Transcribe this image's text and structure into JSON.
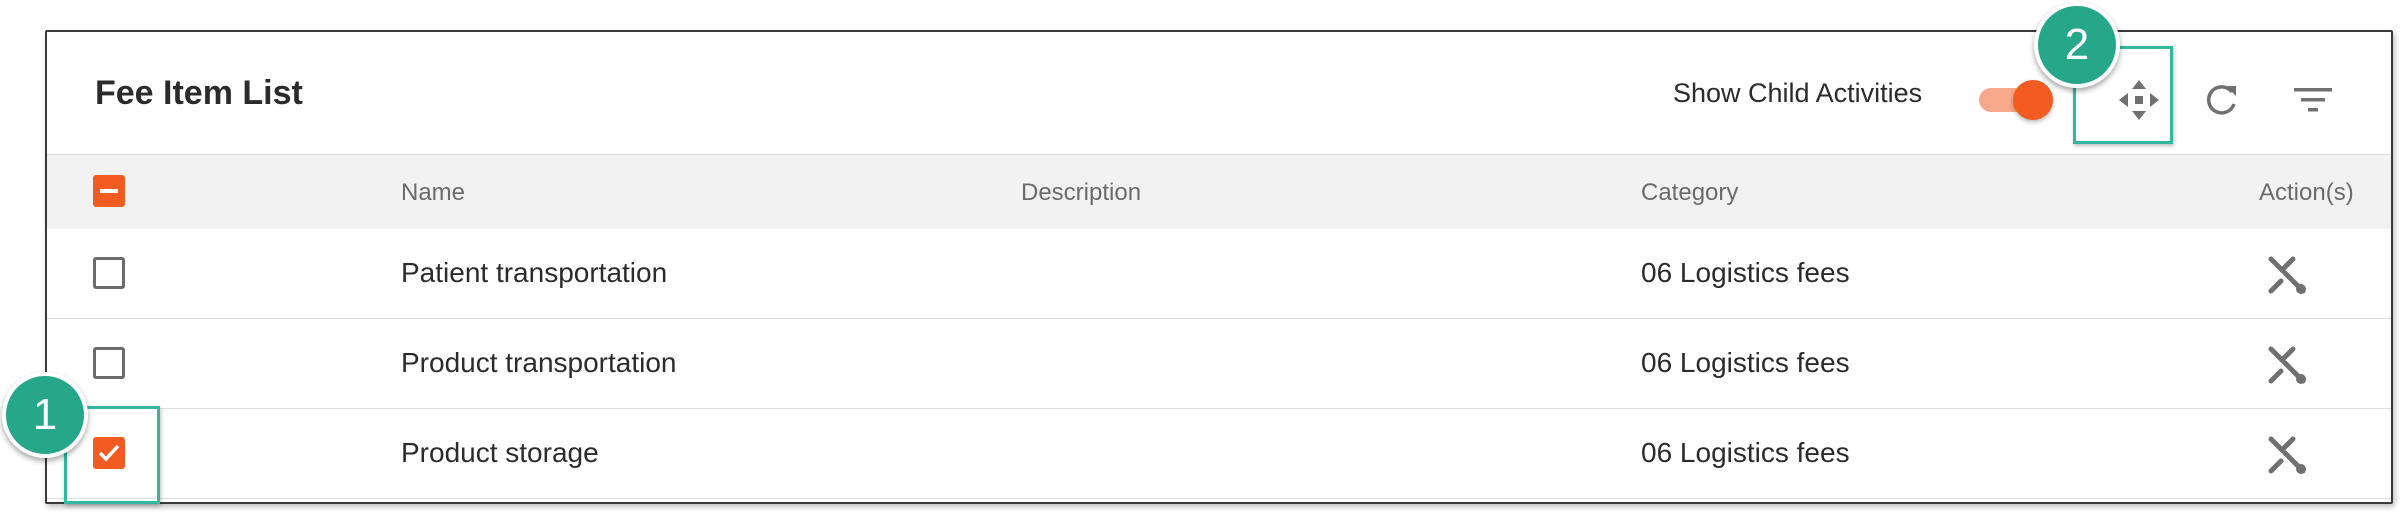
{
  "panel": {
    "title": "Fee Item List",
    "show_child_label": "Show Child Activities",
    "show_child_enabled": true
  },
  "toolbar": {
    "move_icon": "move-arrows-icon",
    "refresh_icon": "refresh-icon",
    "filter_icon": "filter-icon"
  },
  "table": {
    "columns": [
      "Name",
      "Description",
      "Category",
      "Action(s)"
    ],
    "select_all_state": "indeterminate",
    "rows": [
      {
        "name": "Patient transportation",
        "description": "",
        "category": "06 Logistics fees",
        "checked": false,
        "action_icon": "unlink-icon"
      },
      {
        "name": "Product transportation",
        "description": "",
        "category": "06 Logistics fees",
        "checked": false,
        "action_icon": "unlink-icon"
      },
      {
        "name": "Product storage",
        "description": "",
        "category": "06 Logistics fees",
        "checked": true,
        "action_icon": "unlink-icon"
      }
    ]
  },
  "callouts": [
    "1",
    "2"
  ],
  "colors": {
    "accent": "#f25c22",
    "callout": "#27a78a",
    "highlight": "#33b8a0"
  }
}
